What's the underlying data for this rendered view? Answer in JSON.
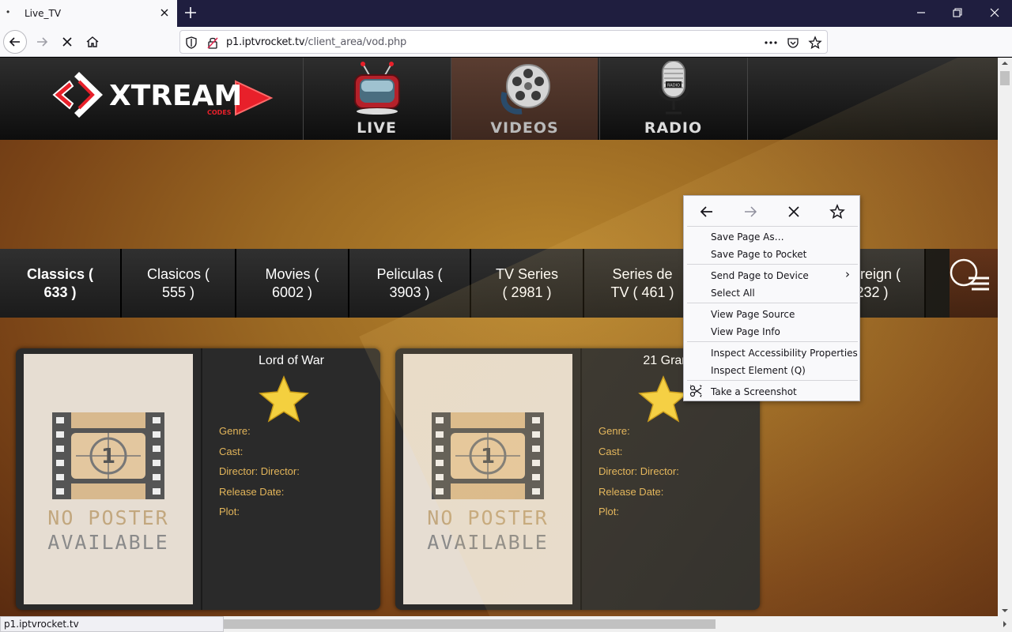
{
  "browser": {
    "tab_title": "Live_TV",
    "url_host": "p1.iptvrocket.tv",
    "url_path": "/client_area/vod.php",
    "status_text": "p1.iptvrocket.tv"
  },
  "site": {
    "logo_text": "XTREAM",
    "logo_sub": "CODES",
    "nav": [
      {
        "label": "LIVE"
      },
      {
        "label": "VIDEOS"
      },
      {
        "label": "RADIO"
      }
    ],
    "radio_sign": "RADIO",
    "categories": [
      {
        "label": "Classics (\n633 )"
      },
      {
        "label": "Clasicos (\n555 )"
      },
      {
        "label": "Movies (\n6002 )"
      },
      {
        "label": "Peliculas (\n3903 )"
      },
      {
        "label": "TV Series\n( 2981 )"
      },
      {
        "label": "Series de\nTV ( 461 )"
      },
      {
        "label": "Foreign (\n232 )"
      }
    ],
    "cards": [
      {
        "title": "Lord of War",
        "poster_line1": "NO POSTER",
        "poster_line2": "AVAILABLE",
        "poster_number": "1",
        "genre": "Genre:",
        "cast": "Cast:",
        "director": "Director: Director:",
        "release": "Release Date:",
        "plot": "Plot:"
      },
      {
        "title": "21 Grams",
        "poster_line1": "NO POSTER",
        "poster_line2": "AVAILABLE",
        "poster_number": "1",
        "genre": "Genre:",
        "cast": "Cast:",
        "director": "Director: Director:",
        "release": "Release Date:",
        "plot": "Plot:"
      }
    ]
  },
  "context_menu": {
    "items": [
      "Save Page As…",
      "Save Page to Pocket",
      "Send Page to Device",
      "Select All",
      "View Page Source",
      "View Page Info",
      "Inspect Accessibility Properties",
      "Inspect Element (Q)",
      "Take a Screenshot"
    ],
    "submenu_arrow": "›"
  },
  "colors": {
    "tabbar": "#1f1e3f",
    "accent_gold": "#e3b55a",
    "logo_red": "#e8202a"
  },
  "icons": [
    "back-arrow-icon",
    "forward-arrow-icon",
    "stop-icon",
    "home-icon",
    "shield-icon",
    "insecure-lock-icon",
    "page-actions-icon",
    "pocket-icon",
    "bookmark-star-icon",
    "library-icon",
    "sidebar-icon",
    "account-icon",
    "menu-icon",
    "search-icon",
    "star-icon",
    "screenshot-icon"
  ]
}
